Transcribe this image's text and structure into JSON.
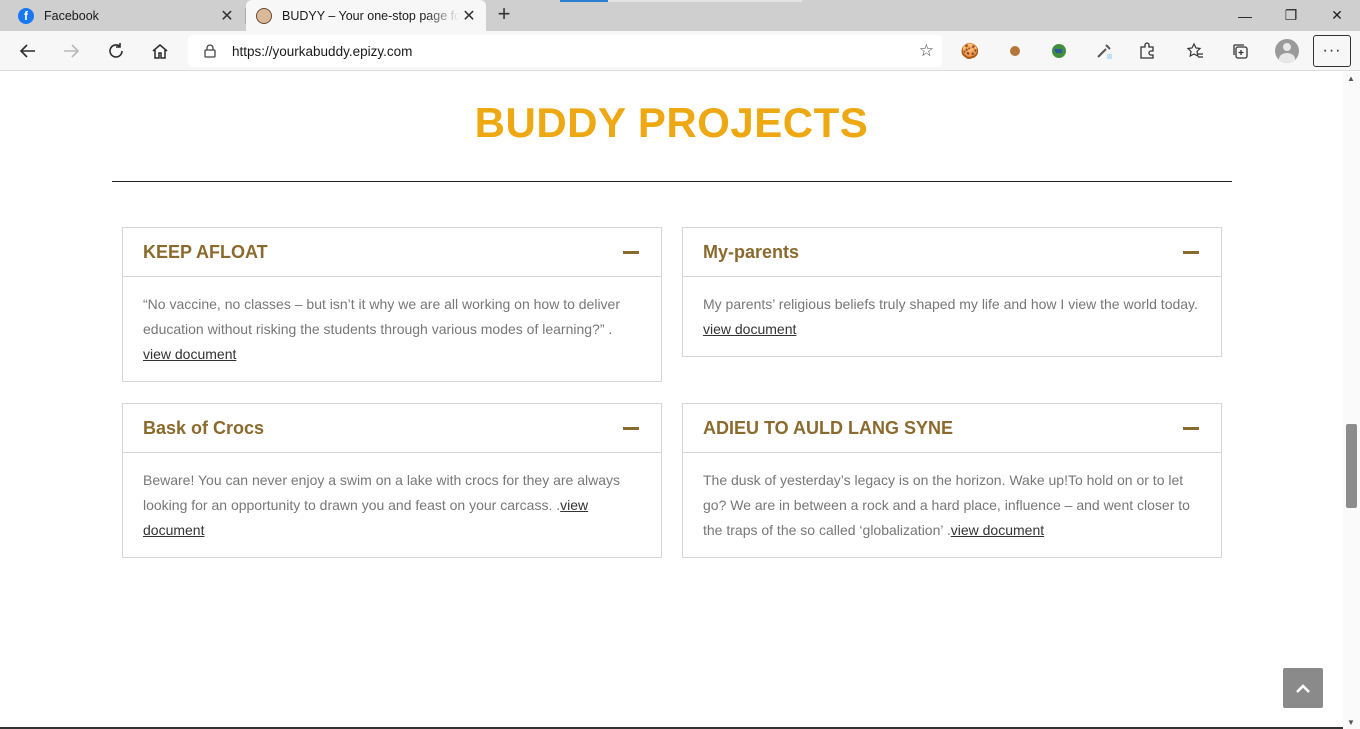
{
  "browser": {
    "tabs": [
      {
        "title": "Facebook",
        "favicon": "facebook-icon"
      },
      {
        "title": "BUDYY – Your one-stop page for",
        "favicon": "budyy-favicon"
      }
    ],
    "url": "https://yourkabuddy.epizy.com",
    "window_controls": {
      "minimize": "—",
      "restore": "❐",
      "close": "✕"
    }
  },
  "page": {
    "section_title": "BUDDY PROJECTS",
    "accent_color": "#eea811",
    "card_title_color": "#8b6a2e",
    "cards": [
      {
        "title": "KEEP AFLOAT",
        "text": "“No vaccine, no classes – but isn’t it why we are all working on how to deliver education without risking the students through various modes of learning?” .",
        "link": "view document"
      },
      {
        "title": "My-parents",
        "text": "My parents’ religious beliefs truly shaped my life and how I view the world today.",
        "link": "view document"
      },
      {
        "title": "Bask of Crocs",
        "text": "Beware! You can never enjoy a swim on a lake with crocs for they are always looking for an opportunity to drawn you and feast on your carcass. .",
        "link": "view document"
      },
      {
        "title": "ADIEU TO AULD LANG SYNE",
        "text": "The dusk of yesterday’s legacy is on the horizon. Wake up!To hold on or to let go? We are in between a rock and a hard place, influence – and went closer to the traps of the so called ‘globalization’ .",
        "link": "view document"
      }
    ]
  }
}
